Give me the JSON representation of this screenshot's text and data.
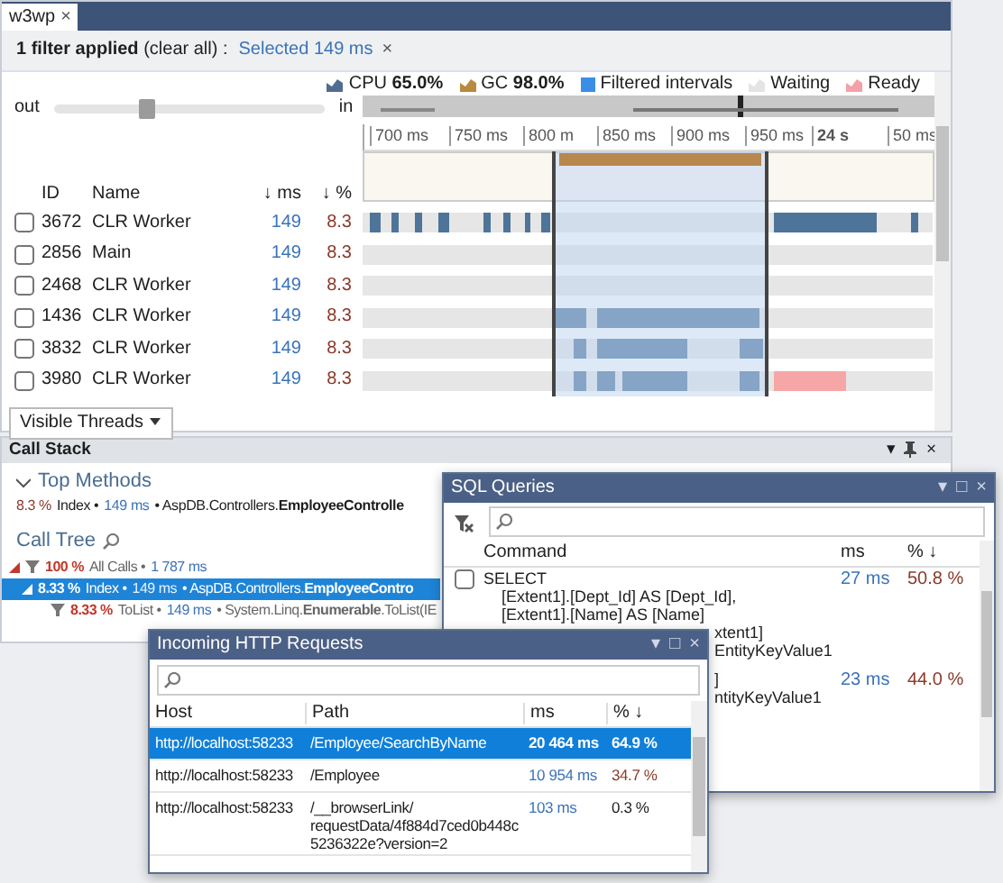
{
  "main_panel": {
    "tab": {
      "label": "w3wp",
      "close": "×",
      "selected": true
    },
    "filter_bar": {
      "summary_prefix": "**1 filter applied** (",
      "clear_link": "clear all",
      "summary_suffix": ") :",
      "chip": "Selected 149 ms",
      "chip_close": "×"
    },
    "legend": [
      {
        "kind": "chart",
        "label": "CPU **65.0%**",
        "color": "#4f6d8f"
      },
      {
        "kind": "chart",
        "label": "GC **98.0%**",
        "color": "#b8893e"
      },
      {
        "kind": "square",
        "label": "Filtered intervals",
        "color": "#3a8ee6"
      },
      {
        "kind": "chart",
        "label": "Waiting",
        "color": "#e4e4e4"
      },
      {
        "kind": "chart",
        "label": "Ready",
        "color": "#f4a0a8"
      }
    ],
    "zoom": {
      "out_label": "out",
      "in_label": "in",
      "level": 0.34
    },
    "ruler_labels": [
      {
        "text": "700 ms",
        "bold": false
      },
      {
        "text": "750 ms",
        "bold": false
      },
      {
        "text": "800 m",
        "bold": false
      },
      {
        "text": "850 ms",
        "bold": false
      },
      {
        "text": "900 ms",
        "bold": false
      },
      {
        "text": "950 ms",
        "bold": false
      },
      {
        "text": "24 s",
        "bold": true
      },
      {
        "text": "50 ms",
        "bold": false
      }
    ],
    "columns": [
      "ID",
      "Name",
      "↓ ms",
      "↓ %"
    ],
    "threads": [
      {
        "id": "3672",
        "name": "CLR Worker",
        "ms": "149",
        "percent": "8.3",
        "checked": false
      },
      {
        "id": "2856",
        "name": "Main",
        "ms": "149",
        "percent": "8.3",
        "checked": false
      },
      {
        "id": "2468",
        "name": "CLR Worker",
        "ms": "149",
        "percent": "8.3",
        "checked": false
      },
      {
        "id": "1436",
        "name": "CLR Worker",
        "ms": "149",
        "percent": "8.3",
        "checked": false
      },
      {
        "id": "3832",
        "name": "CLR Worker",
        "ms": "149",
        "percent": "8.3",
        "checked": false
      },
      {
        "id": "3980",
        "name": "CLR Worker",
        "ms": "149",
        "percent": "8.3",
        "checked": false
      }
    ],
    "visible_threads_button": "Visible Threads"
  },
  "call_stack": {
    "title": "Call Stack",
    "window_controls": [
      "▾",
      "×"
    ],
    "top_methods": {
      "title": "Top Methods",
      "expanded": true,
      "items": [
        {
          "percent": "8.3 %",
          "parts": [
            {
              "kind": "plain",
              "text": "Index •"
            },
            {
              "kind": "time",
              "text": "149 ms"
            },
            {
              "kind": "plain",
              "text": "• AspDB.Controllers.**EmployeeControlle**"
            }
          ]
        }
      ]
    },
    "call_tree": {
      "title": "Call Tree",
      "nodes": [
        {
          "percent": "100 %",
          "hot_path": true,
          "expanded": true,
          "selected": false,
          "parts": [
            {
              "kind": "dim",
              "text": "All Calls •"
            },
            {
              "kind": "time",
              "text": "1 787 ms"
            }
          ],
          "children": [
            {
              "percent": "8.33 %",
              "hot_path": false,
              "expanded": true,
              "selected": true,
              "parts": [
                {
                  "kind": "plain",
                  "text": "Index •"
                },
                {
                  "kind": "time",
                  "text": "149 ms"
                },
                {
                  "kind": "plain",
                  "text": "• AspDB.Controllers.**EmployeeContro**"
                }
              ],
              "children": [
                {
                  "percent": "8.33 %",
                  "hot_path": true,
                  "selected": false,
                  "parts": [
                    {
                      "kind": "dim",
                      "text": "ToList •"
                    },
                    {
                      "kind": "time",
                      "text": "149 ms"
                    },
                    {
                      "kind": "dim",
                      "text": "• System.Linq.**Enumerable**.ToList(IE"
                    }
                  ]
                }
              ]
            }
          ]
        }
      ]
    }
  },
  "sql_queries": {
    "title": "SQL Queries",
    "window_controls": [
      "▾",
      "□",
      "×"
    ],
    "columns": [
      "Command",
      "ms",
      "% ↓"
    ],
    "rows": [
      {
        "checked": false,
        "ms": "27 ms",
        "percent": "50.8 %",
        "lines": [
          {
            "kind": "head",
            "text": "SELECT"
          },
          {
            "kind": "body",
            "text": "[Extent1].[Dept_Id] AS [Dept_Id],"
          },
          {
            "kind": "body",
            "text": "[Extent1].[Name] AS [Name]"
          },
          {
            "kind": "clipped",
            "text": "xtent1]"
          },
          {
            "kind": "clipped",
            "text": "EntityKeyValue1"
          }
        ]
      },
      {
        "ms": "23 ms",
        "percent": "44.0 %",
        "lines": [
          {
            "kind": "clipped",
            "text": "]"
          },
          {
            "kind": "clipped",
            "text": "ntityKeyValue1"
          }
        ]
      }
    ]
  },
  "http_requests": {
    "title": "Incoming HTTP Requests",
    "window_controls": [
      "▾",
      "□",
      "×"
    ],
    "columns": [
      "Host",
      "Path",
      "ms",
      "% ↓"
    ],
    "rows": [
      {
        "host": "http://localhost:58233",
        "path": "/Employee/SearchByName",
        "ms": "20 464 ms",
        "percent": "64.9 %",
        "emphasis": true,
        "selected": true
      },
      {
        "host": "http://localhost:58233",
        "path": "/Employee",
        "ms": "10 954 ms",
        "percent": "34.7 %",
        "emphasis": true,
        "selected": false
      },
      {
        "host": "http://localhost:58233",
        "path": "/__browserLink/ requestData/4f884d7ced0b448c 5236322e?version=2",
        "ms": "103 ms",
        "percent": "0.3 %",
        "emphasis": false,
        "selected": false
      }
    ]
  }
}
